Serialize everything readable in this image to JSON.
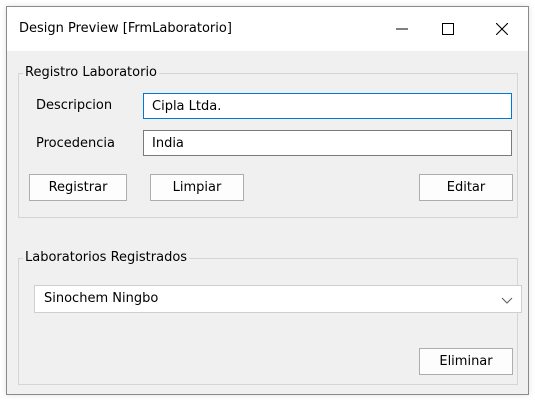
{
  "window": {
    "title": "Design Preview [FrmLaboratorio]"
  },
  "registro": {
    "legend": "Registro Laboratorio",
    "descripcion_label": "Descripcion",
    "descripcion_value": "Cipla Ltda.",
    "procedencia_label": "Procedencia",
    "procedencia_value": "India",
    "registrar_label": "Registrar",
    "limpiar_label": "Limpiar",
    "editar_label": "Editar"
  },
  "registrados": {
    "legend": "Laboratorios Registrados",
    "selected_value": "Sinochem Ningbo",
    "eliminar_label": "Eliminar"
  },
  "colors": {
    "focus_border": "#0078d7",
    "window_bg": "#f0f0f0"
  }
}
